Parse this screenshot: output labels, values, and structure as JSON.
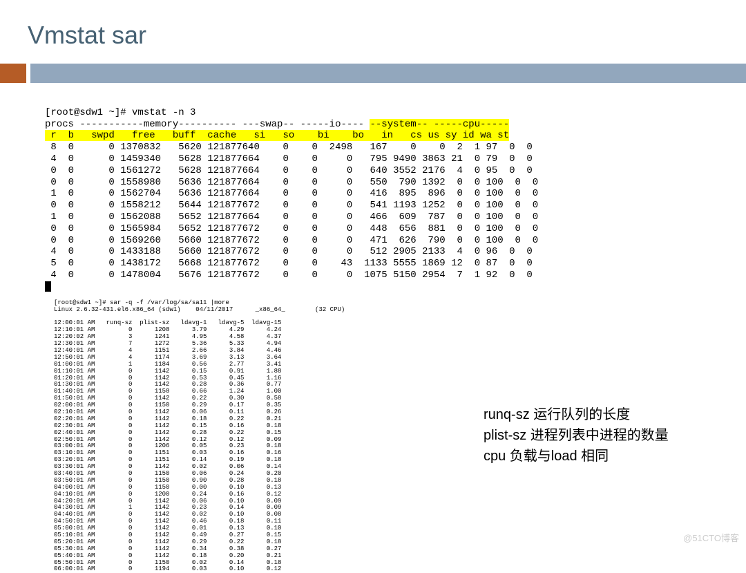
{
  "title": "Vmstat sar",
  "vmstat": {
    "prompt": "[root@sdw1 ~]# vmstat -n 3",
    "hdr1_a": "procs -----------memory---------- ---swap-- -----io---- ",
    "hdr1_sys": "--system--",
    "hdr1_cpu": " -----cpu-----",
    "hdr2_a": " r  b   swpd   free   buff  cache   si   so    bi    bo   ",
    "hdr2_b": "in   cs",
    "hdr2_c": " us sy id wa st",
    "rows": [
      " 8  0      0 1370832   5620 121877640    0    0  2498   167    0    0  2  1 97  0  0",
      " 4  0      0 1459340   5628 121877664    0    0     0   795 9490 3863 21  0 79  0  0",
      " 0  0      0 1561272   5628 121877664    0    0     0   640 3552 2176  4  0 95  0  0",
      " 0  0      0 1558980   5636 121877664    0    0     0   550  790 1392  0  0 100  0  0",
      " 1  0      0 1562704   5636 121877664    0    0     0   416  895  896  0  0 100  0  0",
      " 0  0      0 1558212   5644 121877672    0    0     0   541 1193 1252  0  0 100  0  0",
      " 1  0      0 1562088   5652 121877664    0    0     0   466  609  787  0  0 100  0  0",
      " 0  0      0 1565984   5652 121877672    0    0     0   448  656  881  0  0 100  0  0",
      " 0  0      0 1569260   5660 121877672    0    0     0   471  626  790  0  0 100  0  0",
      " 4  0      0 1433188   5660 121877672    0    0     0   512 2905 2133  4  0 96  0  0",
      " 5  0      0 1438172   5668 121877672    0    0    43  1133 5555 1869 12  0 87  0  0",
      " 4  0      0 1478004   5676 121877672    0    0     0  1075 5150 2954  7  1 92  0  0"
    ]
  },
  "sar_header_1": "[root@sdw1 ~]# sar -q -f /var/log/sa/sa11 |more",
  "sar_header_2": "Linux 2.6.32-431.el6.x86_64 (sdw1)    04/11/2017      _x86_64_        (32 CPU)",
  "sar_cols": "12:00:01 AM   runq-sz  plist-sz   ldavg-1   ldavg-5  ldavg-15",
  "sar_rows": [
    "12:10:01 AM         0      1208      3.79      4.29      4.24",
    "12:20:02 AM         3      1241      4.95      4.58      4.37",
    "12:30:01 AM         7      1272      5.36      5.33      4.94",
    "12:40:01 AM         4      1151      2.66      3.84      4.46",
    "12:50:01 AM         4      1174      3.69      3.13      3.64",
    "01:00:01 AM         1      1184      0.56      2.77      3.41",
    "01:10:01 AM         0      1142      0.15      0.91      1.88",
    "01:20:01 AM         0      1142      0.53      0.45      1.16",
    "01:30:01 AM         0      1142      0.28      0.36      0.77",
    "01:40:01 AM         0      1158      0.66      1.24      1.00",
    "01:50:01 AM         0      1142      0.22      0.30      0.58",
    "02:00:01 AM         0      1150      0.29      0.17      0.35",
    "02:10:01 AM         0      1142      0.06      0.11      0.26",
    "02:20:01 AM         0      1142      0.18      0.22      0.21",
    "02:30:01 AM         0      1142      0.15      0.16      0.18",
    "02:40:01 AM         0      1142      0.28      0.22      0.15",
    "02:50:01 AM         0      1142      0.12      0.12      0.09",
    "03:00:01 AM         0      1206      0.05      0.23      0.18",
    "03:10:01 AM         0      1151      0.03      0.16      0.16",
    "03:20:01 AM         0      1151      0.14      0.19      0.18",
    "03:30:01 AM         0      1142      0.02      0.06      0.14",
    "03:40:01 AM         0      1150      0.06      0.24      0.20",
    "03:50:01 AM         0      1150      0.90      0.28      0.18",
    "04:00:01 AM         0      1150      0.00      0.10      0.13",
    "04:10:01 AM         0      1200      0.24      0.16      0.12",
    "04:20:01 AM         0      1142      0.06      0.10      0.09",
    "04:30:01 AM         1      1142      0.23      0.14      0.09",
    "04:40:01 AM         0      1142      0.02      0.10      0.08",
    "04:50:01 AM         0      1142      0.46      0.18      0.11",
    "05:00:01 AM         0      1142      0.01      0.13      0.10",
    "05:10:01 AM         0      1142      0.49      0.27      0.15",
    "05:20:01 AM         0      1142      0.29      0.22      0.18",
    "05:30:01 AM         0      1142      0.34      0.38      0.27",
    "05:40:01 AM         0      1142      0.18      0.20      0.21",
    "05:50:01 AM         0      1150      0.02      0.14      0.18",
    "06:00:01 AM         0      1194      0.03      0.10      0.12"
  ],
  "annot": {
    "l1": "runq-sz 运行队列的长度",
    "l2": "plist-sz 进程列表中进程的数量",
    "l3": "cpu 负载与load 相同"
  },
  "watermark": "@51CTO博客"
}
